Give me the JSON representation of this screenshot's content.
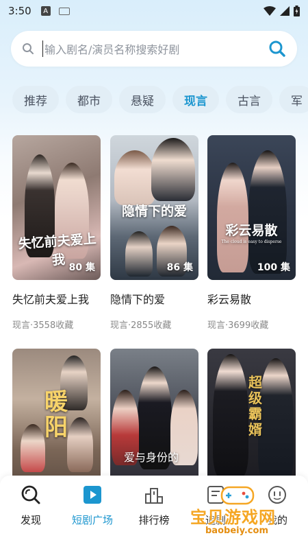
{
  "status_bar": {
    "time": "3:50",
    "notification_letter": "A"
  },
  "search": {
    "placeholder": "输入剧名/演员名称搜索好剧"
  },
  "categories": [
    "推荐",
    "都市",
    "悬疑",
    "现言",
    "古言",
    "军"
  ],
  "active_category": "现言",
  "dramas": [
    {
      "title": "失忆前夫爱上我",
      "poster_title": "失忆前夫爱上我",
      "episodes": "80 集",
      "meta": "现言·3558收藏"
    },
    {
      "title": "隐情下的爱",
      "poster_title": "隐情下的爱",
      "episodes": "86 集",
      "meta": "现言·2855收藏"
    },
    {
      "title": "彩云易散",
      "poster_title": "彩云易散",
      "poster_subtitle": "The cloud is easy to disperse",
      "episodes": "100 集",
      "meta": "现言·3699收藏"
    },
    {
      "poster_title": "暖阳"
    },
    {
      "poster_title": "爱与身份的"
    },
    {
      "poster_title": "超级霸婿"
    }
  ],
  "tabs": [
    {
      "label": "发现",
      "icon": "search-icon"
    },
    {
      "label": "短剧广场",
      "icon": "play-icon"
    },
    {
      "label": "排行榜",
      "icon": "chart-icon"
    },
    {
      "label": "追剧",
      "icon": "list-icon"
    },
    {
      "label": "我的",
      "icon": "face-icon"
    }
  ],
  "active_tab": "短剧广场",
  "watermark": {
    "text": "宝贝游戏网",
    "url": "baobeiy.com"
  },
  "colors": {
    "accent": "#1c96cf",
    "chip_bg": "#e2eef6",
    "watermark": "#f5a623"
  }
}
